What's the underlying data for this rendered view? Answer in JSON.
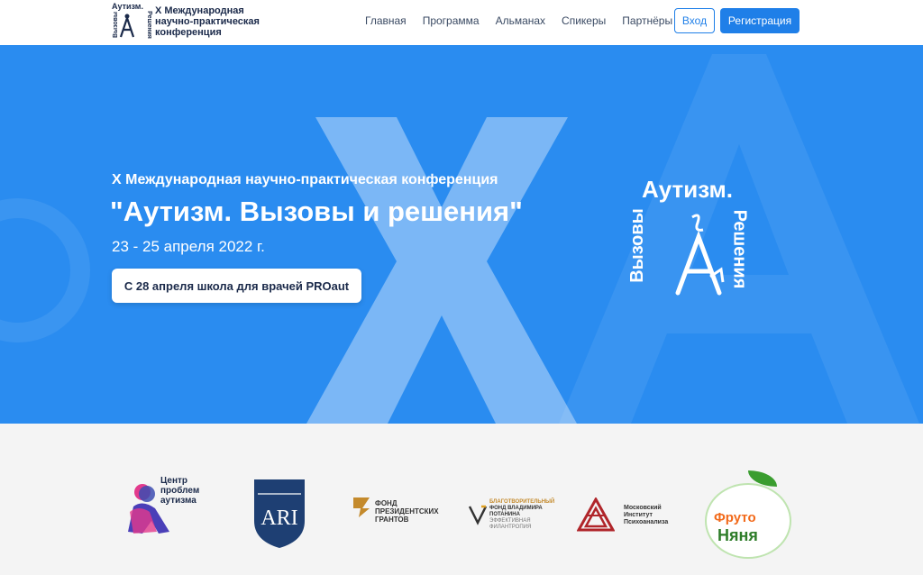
{
  "header": {
    "logo_top": "Аутизм.",
    "logo_left": "Вызовы",
    "logo_right": "Решения",
    "brand_lines": [
      "X Международная",
      "научно-практическая",
      "конференция"
    ],
    "nav": [
      "Главная",
      "Программа",
      "Альманах",
      "Спикеры",
      "Партнёры"
    ],
    "login_label": "Вход",
    "register_label": "Регистрация"
  },
  "hero": {
    "subtitle": "X Международная научно-практическая конференция",
    "title": "\"Аутизм. Вызовы и решения\"",
    "dates": "23 - 25 апреля 2022 г.",
    "cta_label": "С 28 апреля школа для врачей PROaut",
    "logo_top": "Аутизм.",
    "logo_left": "Вызовы",
    "logo_right": "Решения",
    "bg_letter_x": "X",
    "bg_letter_a": "A"
  },
  "partners": {
    "p1_lines": [
      "Центр",
      "проблем",
      "аутизма"
    ],
    "p2_text": "ARI",
    "p3_lines": [
      "ФОНД",
      "ПРЕЗИДЕНТСКИХ",
      "ГРАНТОВ"
    ],
    "p4_lines": [
      "БЛАГОТВОРИТЕЛЬНЫЙ",
      "ФОНД ВЛАДИМИРА",
      "ПОТАНИНА",
      "ЭФФЕКТИВНАЯ ФИЛАНТРОПИЯ"
    ],
    "p5_lines": [
      "Московский",
      "Институт",
      "Психоанализа"
    ],
    "p6_lines": [
      "Фруто",
      "Няня"
    ]
  },
  "colors": {
    "accent": "#1f7fe8",
    "hero_bg": "#2a8cf0",
    "dark_text": "#1b2a4a"
  }
}
